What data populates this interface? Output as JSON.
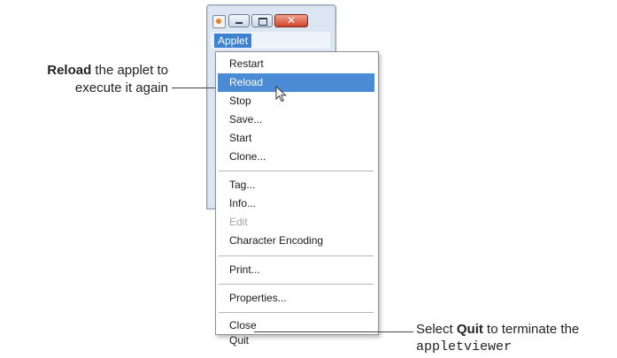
{
  "window": {
    "title_icon": "java-coffee-icon",
    "menubar": {
      "active_menu": "Applet"
    },
    "buttons": {
      "close_glyph": "✕"
    }
  },
  "menu": {
    "items": [
      {
        "label": "Restart",
        "state": "normal"
      },
      {
        "label": "Reload",
        "state": "selected"
      },
      {
        "label": "Stop",
        "state": "normal"
      },
      {
        "label": "Save...",
        "state": "normal"
      },
      {
        "label": "Start",
        "state": "normal"
      },
      {
        "label": "Clone...",
        "state": "normal"
      },
      {
        "label": "Tag...",
        "state": "normal"
      },
      {
        "label": "Info...",
        "state": "normal"
      },
      {
        "label": "Edit",
        "state": "disabled"
      },
      {
        "label": "Character Encoding",
        "state": "normal"
      },
      {
        "label": "Print...",
        "state": "normal"
      },
      {
        "label": "Properties...",
        "state": "normal"
      },
      {
        "label": "Close",
        "state": "normal"
      },
      {
        "label": "Quit",
        "state": "normal"
      }
    ]
  },
  "callouts": {
    "reload": {
      "bold": "Reload",
      "rest_line1": " the applet to",
      "line2": "execute it again"
    },
    "quit": {
      "pre": "Select ",
      "bold": "Quit",
      "post": " to terminate the",
      "code": "appletviewer"
    }
  },
  "colors": {
    "selected_bg": "#4b8bd6",
    "disabled_text": "#a5a5a5",
    "menu_title_bg": "#3c82d0"
  }
}
